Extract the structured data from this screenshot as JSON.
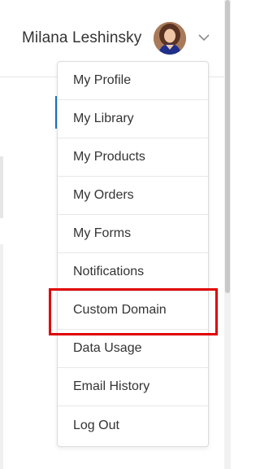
{
  "header": {
    "user_name": "Milana Leshinsky",
    "avatar_icon": "user-avatar",
    "chevron_icon": "chevron-down-icon"
  },
  "menu": {
    "items": [
      {
        "label": "My Profile"
      },
      {
        "label": "My Library"
      },
      {
        "label": "My Products"
      },
      {
        "label": "My Orders"
      },
      {
        "label": "My Forms"
      },
      {
        "label": "Notifications"
      },
      {
        "label": "Custom Domain"
      },
      {
        "label": "Data Usage"
      },
      {
        "label": "Email History"
      },
      {
        "label": "Log Out"
      }
    ],
    "highlighted_item": "Custom Domain",
    "highlight_color": "#e00000"
  }
}
